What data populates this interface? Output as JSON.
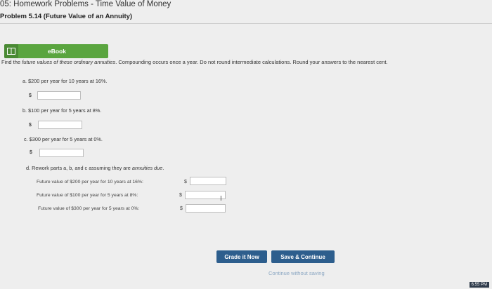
{
  "header": {
    "title": "05: Homework Problems - Time Value of Money",
    "problem": "Problem 5.14 (Future Value of an Annuity)"
  },
  "ebook": {
    "label": "eBook"
  },
  "instructions": {
    "lead": "Find the",
    "italic": "future values of these ordinary annuities",
    "rest": ". Compounding occurs once a year. Do not round intermediate calculations. Round your answers to the nearest cent."
  },
  "questions": {
    "a": "a. $200 per year for 10 years at 16%.",
    "b": "b. $100 per year for 5 years at 8%.",
    "c": "c. $300 per year for 5 years at 0%.",
    "d_lead": "d. Rework parts a, b, and c assuming they are",
    "d_italic": "annuities due",
    "d_tail": "."
  },
  "currency": "$",
  "future_values": {
    "fv1": "Future value of $200 per year for 10 years at 16%:",
    "fv2": "Future value of $100 per year for 5 years at 8%:",
    "fv3": "Future value of $300 per year for 5 years at 0%:"
  },
  "buttons": {
    "grade": "Grade it Now",
    "save": "Save & Continue",
    "continue_link": "Continue without saving"
  },
  "clock": "6:55 PM",
  "colors": {
    "accent_green": "#5aa53f",
    "button_blue": "#2d5e8d"
  }
}
